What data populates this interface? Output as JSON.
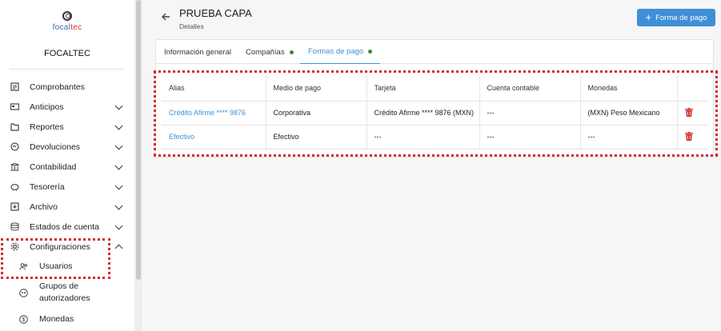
{
  "brand": {
    "logo_a": "focal",
    "logo_b": "tec",
    "company": "FOCALTEC"
  },
  "sidebar": {
    "items": [
      {
        "label": "Comprobantes",
        "icon": "receipt-icon",
        "chevron": false
      },
      {
        "label": "Anticipos",
        "icon": "card-icon",
        "chevron": true
      },
      {
        "label": "Reportes",
        "icon": "folder-icon",
        "chevron": true
      },
      {
        "label": "Devoluciones",
        "icon": "return-icon",
        "chevron": true
      },
      {
        "label": "Contabilidad",
        "icon": "bank-icon",
        "chevron": true
      },
      {
        "label": "Tesorería",
        "icon": "piggy-bank-icon",
        "chevron": true
      },
      {
        "label": "Archivo",
        "icon": "archive-icon",
        "chevron": true
      },
      {
        "label": "Estados de cuenta",
        "icon": "database-icon",
        "chevron": true
      },
      {
        "label": "Configuraciones",
        "icon": "gear-icon",
        "chevron": "up"
      }
    ],
    "sub_items": [
      {
        "label": "Usuarios",
        "icon": "users-icon"
      },
      {
        "label_line1": "Grupos de",
        "label_line2": "autorizadores",
        "icon": "group-icon"
      },
      {
        "label": "Monedas",
        "icon": "dollar-icon"
      }
    ]
  },
  "header": {
    "title": "PRUEBA CAPA",
    "subtitle": "Detalles",
    "action_label": "Forma de pago"
  },
  "tabs": [
    {
      "label": "Información general",
      "dot": false,
      "active": false
    },
    {
      "label": "Compañías",
      "dot": true,
      "active": false
    },
    {
      "label": "Formas de pago",
      "dot": true,
      "active": true
    }
  ],
  "table": {
    "columns": [
      "Alias",
      "Medio de pago",
      "Tarjeta",
      "Cuenta contable",
      "Monedas",
      ""
    ],
    "rows": [
      [
        "Crédito Afirme **** 9876",
        "Corporativa",
        "Crédito Afirme **** 9876 (MXN)",
        "---",
        "(MXN) Peso Mexicano"
      ],
      [
        "Efectivo",
        "Efectivo",
        "---",
        "---",
        "---"
      ]
    ]
  },
  "colors": {
    "primary": "#3f8fd6",
    "danger": "#d52b2b",
    "dot_green": "#3a8a3a"
  }
}
